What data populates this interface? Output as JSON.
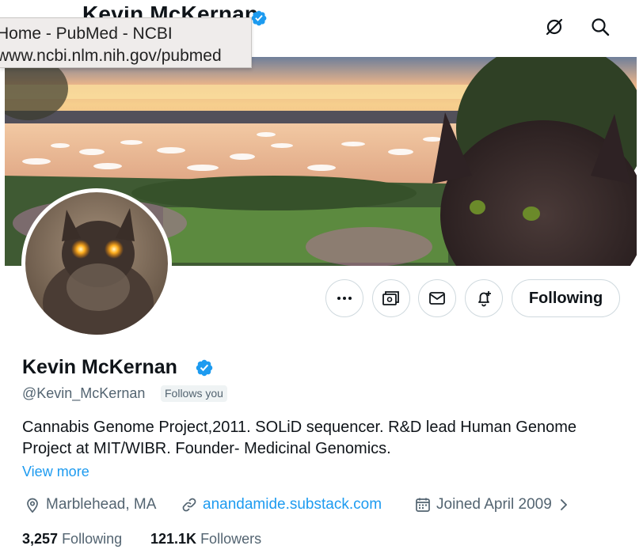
{
  "header": {
    "title": "Kevin McKernan",
    "tooltip_title": "Home - PubMed - NCBI",
    "tooltip_url": "www.ncbi.nlm.nih.gov/pubmed"
  },
  "actions": {
    "follow_label": "Following"
  },
  "profile": {
    "name": "Kevin McKernan",
    "handle": "@Kevin_McKernan",
    "follows_you": "Follows you",
    "bio": "Cannabis Genome Project,2011. SOLiD sequencer. R&D lead Human Genome Project at MIT/WIBR. Founder- Medicinal Genomics.",
    "view_more": "View more",
    "location": "Marblehead, MA",
    "website": "anandamide.substack.com",
    "joined": "Joined April 2009",
    "following_count": "3,257",
    "following_label": "Following",
    "followers_count": "121.1K",
    "followers_label": "Followers"
  },
  "colors": {
    "accent": "#1d9bf0",
    "verified": "#1d9bf0",
    "muted_text": "#536471"
  },
  "icons": [
    "verified-badge-icon",
    "no-translate-icon",
    "search-icon",
    "more-icon",
    "subscribe-icon",
    "message-icon",
    "notification-bell-icon",
    "location-icon",
    "link-icon",
    "calendar-icon",
    "chevron-right-icon"
  ]
}
